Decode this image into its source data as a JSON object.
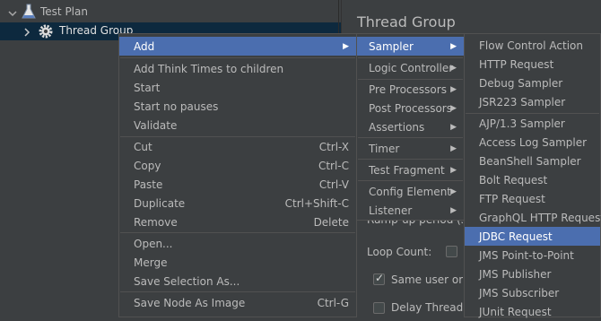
{
  "tree": {
    "root_label": "Test Plan",
    "child_label": "Thread Group"
  },
  "right_panel": {
    "title": "Thread Group",
    "ramp_up_label": "Ramp-up period (seconds):",
    "loop_count_label": "Loop Count:",
    "same_user_label": "Same user on each iteration",
    "delay_thread_label": "Delay Thread creation until needed"
  },
  "context_menu": {
    "items": [
      {
        "label": "Add",
        "shortcut": "",
        "submenu": true,
        "highlighted": true
      },
      {
        "label": "Add Think Times to children",
        "shortcut": ""
      },
      {
        "label": "Start",
        "shortcut": ""
      },
      {
        "label": "Start no pauses",
        "shortcut": ""
      },
      {
        "label": "Validate",
        "shortcut": ""
      },
      {
        "label": "Cut",
        "shortcut": "Ctrl-X"
      },
      {
        "label": "Copy",
        "shortcut": "Ctrl-C"
      },
      {
        "label": "Paste",
        "shortcut": "Ctrl-V"
      },
      {
        "label": "Duplicate",
        "shortcut": "Ctrl+Shift-C"
      },
      {
        "label": "Remove",
        "shortcut": "Delete"
      },
      {
        "label": "Open...",
        "shortcut": ""
      },
      {
        "label": "Merge",
        "shortcut": ""
      },
      {
        "label": "Save Selection As...",
        "shortcut": ""
      },
      {
        "label": "Save Node As Image",
        "shortcut": "Ctrl-G"
      }
    ]
  },
  "add_submenu": {
    "items": [
      {
        "label": "Sampler",
        "highlighted": true
      },
      {
        "label": "Logic Controller"
      },
      {
        "label": "Pre Processors"
      },
      {
        "label": "Post Processors"
      },
      {
        "label": "Assertions"
      },
      {
        "label": "Timer"
      },
      {
        "label": "Test Fragment"
      },
      {
        "label": "Config Element"
      },
      {
        "label": "Listener"
      }
    ]
  },
  "sampler_submenu": {
    "items": [
      {
        "label": "Flow Control Action"
      },
      {
        "label": "HTTP Request"
      },
      {
        "label": "Debug Sampler"
      },
      {
        "label": "JSR223 Sampler"
      },
      {
        "label": "AJP/1.3 Sampler"
      },
      {
        "label": "Access Log Sampler"
      },
      {
        "label": "BeanShell Sampler"
      },
      {
        "label": "Bolt Request"
      },
      {
        "label": "FTP Request"
      },
      {
        "label": "GraphQL HTTP Request"
      },
      {
        "label": "JDBC Request",
        "highlighted": true
      },
      {
        "label": "JMS Point-to-Point"
      },
      {
        "label": "JMS Publisher"
      },
      {
        "label": "JMS Subscriber"
      },
      {
        "label": "JUnit Request"
      }
    ]
  },
  "colors": {
    "background": "#3c3f41",
    "highlight": "#4b6eaf",
    "tree_selection": "#0d293e",
    "text": "#bbbbbb"
  }
}
